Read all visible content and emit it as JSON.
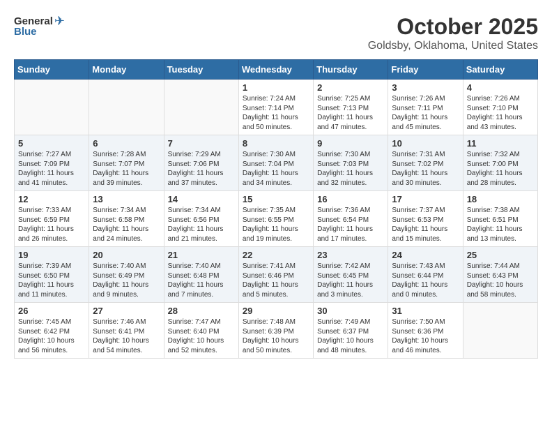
{
  "header": {
    "logo_general": "General",
    "logo_blue": "Blue",
    "month": "October 2025",
    "location": "Goldsby, Oklahoma, United States"
  },
  "days_of_week": [
    "Sunday",
    "Monday",
    "Tuesday",
    "Wednesday",
    "Thursday",
    "Friday",
    "Saturday"
  ],
  "weeks": [
    [
      {
        "day": "",
        "info": ""
      },
      {
        "day": "",
        "info": ""
      },
      {
        "day": "",
        "info": ""
      },
      {
        "day": "1",
        "info": "Sunrise: 7:24 AM\nSunset: 7:14 PM\nDaylight: 11 hours\nand 50 minutes."
      },
      {
        "day": "2",
        "info": "Sunrise: 7:25 AM\nSunset: 7:13 PM\nDaylight: 11 hours\nand 47 minutes."
      },
      {
        "day": "3",
        "info": "Sunrise: 7:26 AM\nSunset: 7:11 PM\nDaylight: 11 hours\nand 45 minutes."
      },
      {
        "day": "4",
        "info": "Sunrise: 7:26 AM\nSunset: 7:10 PM\nDaylight: 11 hours\nand 43 minutes."
      }
    ],
    [
      {
        "day": "5",
        "info": "Sunrise: 7:27 AM\nSunset: 7:09 PM\nDaylight: 11 hours\nand 41 minutes."
      },
      {
        "day": "6",
        "info": "Sunrise: 7:28 AM\nSunset: 7:07 PM\nDaylight: 11 hours\nand 39 minutes."
      },
      {
        "day": "7",
        "info": "Sunrise: 7:29 AM\nSunset: 7:06 PM\nDaylight: 11 hours\nand 37 minutes."
      },
      {
        "day": "8",
        "info": "Sunrise: 7:30 AM\nSunset: 7:04 PM\nDaylight: 11 hours\nand 34 minutes."
      },
      {
        "day": "9",
        "info": "Sunrise: 7:30 AM\nSunset: 7:03 PM\nDaylight: 11 hours\nand 32 minutes."
      },
      {
        "day": "10",
        "info": "Sunrise: 7:31 AM\nSunset: 7:02 PM\nDaylight: 11 hours\nand 30 minutes."
      },
      {
        "day": "11",
        "info": "Sunrise: 7:32 AM\nSunset: 7:00 PM\nDaylight: 11 hours\nand 28 minutes."
      }
    ],
    [
      {
        "day": "12",
        "info": "Sunrise: 7:33 AM\nSunset: 6:59 PM\nDaylight: 11 hours\nand 26 minutes."
      },
      {
        "day": "13",
        "info": "Sunrise: 7:34 AM\nSunset: 6:58 PM\nDaylight: 11 hours\nand 24 minutes."
      },
      {
        "day": "14",
        "info": "Sunrise: 7:34 AM\nSunset: 6:56 PM\nDaylight: 11 hours\nand 21 minutes."
      },
      {
        "day": "15",
        "info": "Sunrise: 7:35 AM\nSunset: 6:55 PM\nDaylight: 11 hours\nand 19 minutes."
      },
      {
        "day": "16",
        "info": "Sunrise: 7:36 AM\nSunset: 6:54 PM\nDaylight: 11 hours\nand 17 minutes."
      },
      {
        "day": "17",
        "info": "Sunrise: 7:37 AM\nSunset: 6:53 PM\nDaylight: 11 hours\nand 15 minutes."
      },
      {
        "day": "18",
        "info": "Sunrise: 7:38 AM\nSunset: 6:51 PM\nDaylight: 11 hours\nand 13 minutes."
      }
    ],
    [
      {
        "day": "19",
        "info": "Sunrise: 7:39 AM\nSunset: 6:50 PM\nDaylight: 11 hours\nand 11 minutes."
      },
      {
        "day": "20",
        "info": "Sunrise: 7:40 AM\nSunset: 6:49 PM\nDaylight: 11 hours\nand 9 minutes."
      },
      {
        "day": "21",
        "info": "Sunrise: 7:40 AM\nSunset: 6:48 PM\nDaylight: 11 hours\nand 7 minutes."
      },
      {
        "day": "22",
        "info": "Sunrise: 7:41 AM\nSunset: 6:46 PM\nDaylight: 11 hours\nand 5 minutes."
      },
      {
        "day": "23",
        "info": "Sunrise: 7:42 AM\nSunset: 6:45 PM\nDaylight: 11 hours\nand 3 minutes."
      },
      {
        "day": "24",
        "info": "Sunrise: 7:43 AM\nSunset: 6:44 PM\nDaylight: 11 hours\nand 0 minutes."
      },
      {
        "day": "25",
        "info": "Sunrise: 7:44 AM\nSunset: 6:43 PM\nDaylight: 10 hours\nand 58 minutes."
      }
    ],
    [
      {
        "day": "26",
        "info": "Sunrise: 7:45 AM\nSunset: 6:42 PM\nDaylight: 10 hours\nand 56 minutes."
      },
      {
        "day": "27",
        "info": "Sunrise: 7:46 AM\nSunset: 6:41 PM\nDaylight: 10 hours\nand 54 minutes."
      },
      {
        "day": "28",
        "info": "Sunrise: 7:47 AM\nSunset: 6:40 PM\nDaylight: 10 hours\nand 52 minutes."
      },
      {
        "day": "29",
        "info": "Sunrise: 7:48 AM\nSunset: 6:39 PM\nDaylight: 10 hours\nand 50 minutes."
      },
      {
        "day": "30",
        "info": "Sunrise: 7:49 AM\nSunset: 6:37 PM\nDaylight: 10 hours\nand 48 minutes."
      },
      {
        "day": "31",
        "info": "Sunrise: 7:50 AM\nSunset: 6:36 PM\nDaylight: 10 hours\nand 46 minutes."
      },
      {
        "day": "",
        "info": ""
      }
    ]
  ]
}
